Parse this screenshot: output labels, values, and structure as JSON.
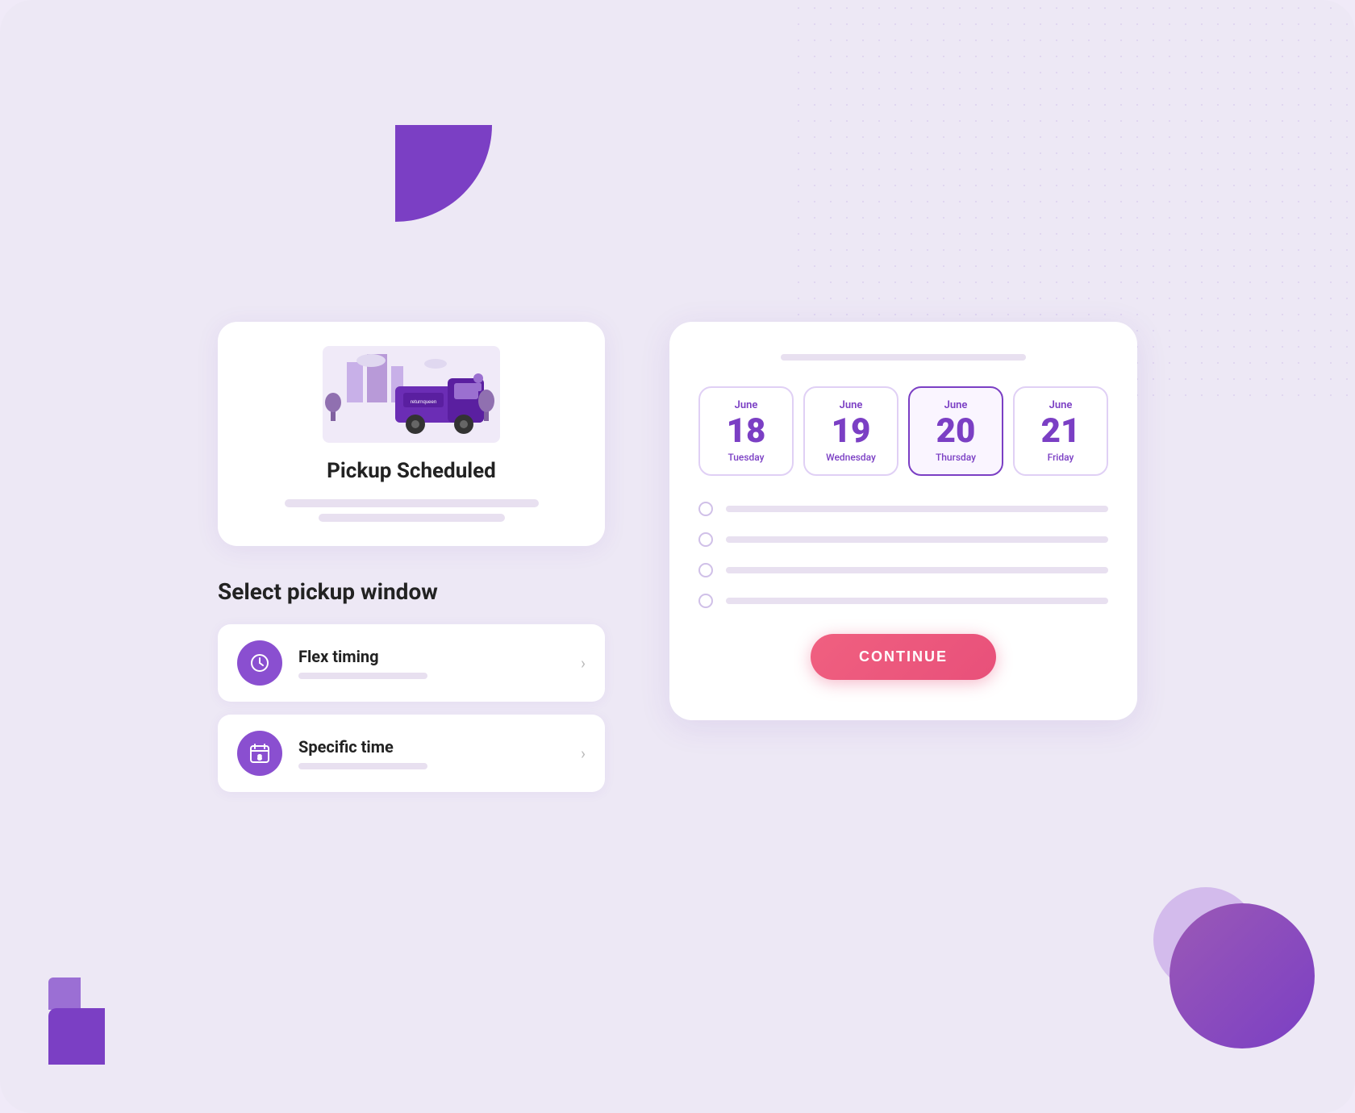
{
  "page": {
    "background": "#ede8f5"
  },
  "pickup_card": {
    "title": "Pickup Scheduled"
  },
  "select_section": {
    "title": "Select pickup window",
    "options": [
      {
        "id": "flex",
        "label": "Flex timing",
        "icon_type": "clock"
      },
      {
        "id": "specific",
        "label": "Specific time",
        "icon_type": "calendar-number"
      }
    ]
  },
  "calendar": {
    "dates": [
      {
        "month": "June",
        "day": "18",
        "weekday": "Tuesday",
        "selected": false
      },
      {
        "month": "June",
        "day": "19",
        "weekday": "Wednesday",
        "selected": false
      },
      {
        "month": "June",
        "day": "20",
        "weekday": "Thursday",
        "selected": true
      },
      {
        "month": "June",
        "day": "21",
        "weekday": "Friday",
        "selected": false
      }
    ],
    "time_slots": 4,
    "continue_button": "CONTINUE"
  }
}
